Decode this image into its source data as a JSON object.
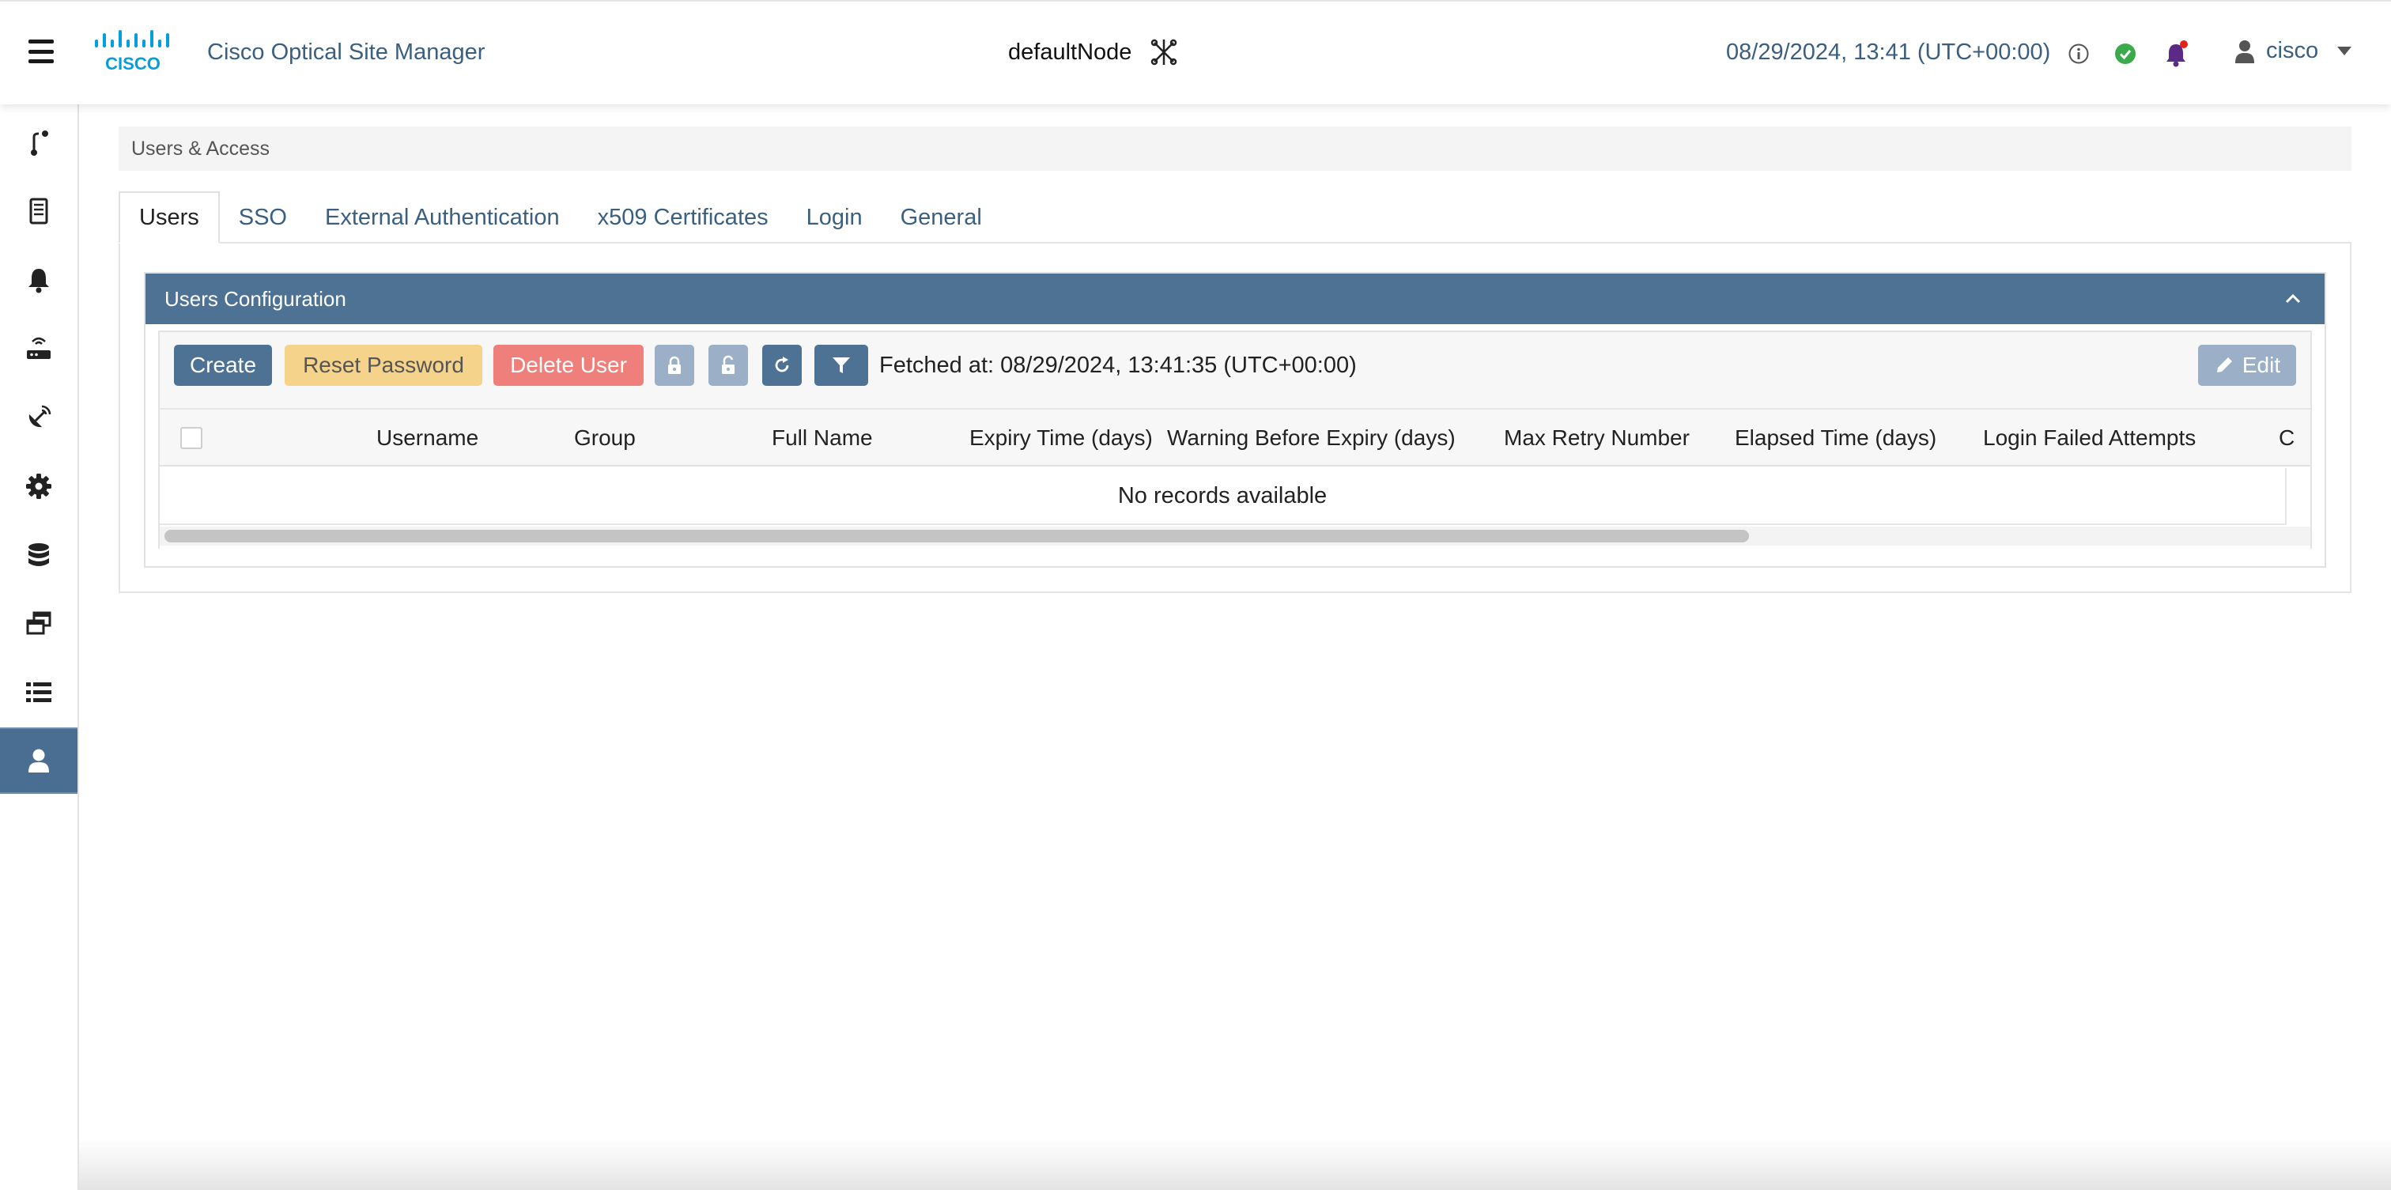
{
  "header": {
    "app_title": "Cisco Optical Site Manager",
    "logo_text": "CISCO",
    "node_name": "defaultNode",
    "datetime": "08/29/2024, 13:41 (UTC+00:00)",
    "user": "cisco"
  },
  "sidebar": {
    "items": [
      {
        "icon": "route-icon"
      },
      {
        "icon": "device-icon"
      },
      {
        "icon": "bell-icon"
      },
      {
        "icon": "router-icon"
      },
      {
        "icon": "satellite-icon"
      },
      {
        "icon": "gear-icon"
      },
      {
        "icon": "database-icon"
      },
      {
        "icon": "windows-icon"
      },
      {
        "icon": "list-icon"
      },
      {
        "icon": "user-icon",
        "active": true
      }
    ]
  },
  "breadcrumb": "Users & Access",
  "tabs": [
    {
      "label": "Users",
      "active": true
    },
    {
      "label": "SSO"
    },
    {
      "label": "External Authentication"
    },
    {
      "label": "x509 Certificates"
    },
    {
      "label": "Login"
    },
    {
      "label": "General"
    }
  ],
  "panel": {
    "title": "Users Configuration",
    "toolbar": {
      "create": "Create",
      "reset_password": "Reset Password",
      "delete_user": "Delete User",
      "fetched": "Fetched at: 08/29/2024, 13:41:35 (UTC+00:00)",
      "edit": "Edit"
    },
    "columns": [
      "Username",
      "Group",
      "Full Name",
      "Expiry Time (days)",
      "Warning Before Expiry (days)",
      "Max Retry Number",
      "Elapsed Time (days)",
      "Login Failed Attempts",
      "C"
    ],
    "empty_message": "No records available"
  },
  "colors": {
    "primary": "#4e7294",
    "warning": "#f5d38a",
    "danger": "#ef7f7a",
    "disabled": "#9bb0c6",
    "link": "#3a5f80",
    "ok": "#3aaa4a",
    "notify": "#5b2a86"
  }
}
